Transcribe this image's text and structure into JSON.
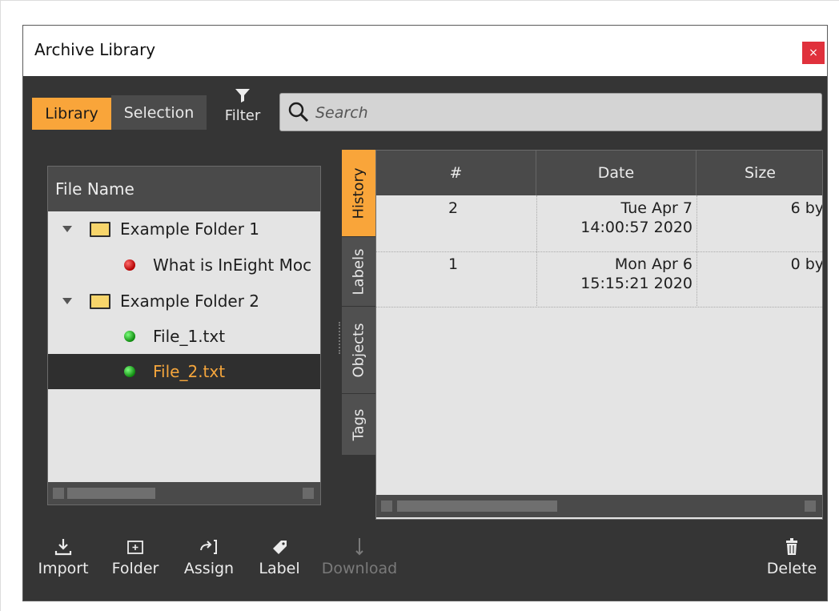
{
  "window": {
    "title": "Archive Library",
    "close_label": "×"
  },
  "tabs": {
    "library": "Library",
    "selection": "Selection"
  },
  "filter": {
    "label": "Filter",
    "icon": "funnel-icon"
  },
  "search": {
    "placeholder": "Search",
    "value": ""
  },
  "tree": {
    "header": "File Name",
    "rows": [
      {
        "label": "Example Folder 1",
        "type": "folder",
        "expanded": true
      },
      {
        "label": "What is InEight Moc",
        "type": "file",
        "status": "red"
      },
      {
        "label": "Example Folder 2",
        "type": "folder",
        "expanded": true
      },
      {
        "label": "File_1.txt",
        "type": "file",
        "status": "green"
      },
      {
        "label": "File_2.txt",
        "type": "file",
        "status": "green",
        "selected": true
      }
    ]
  },
  "side_tabs": [
    "History",
    "Labels",
    "Objects",
    "Tags"
  ],
  "side_tabs_active": "History",
  "history": {
    "columns": [
      "#",
      "Date",
      "Size"
    ],
    "rows": [
      {
        "num": "2",
        "date_line1": "Tue Apr 7",
        "date_line2": "14:00:57 2020",
        "size": "6 by"
      },
      {
        "num": "1",
        "date_line1": "Mon Apr 6",
        "date_line2": "15:15:21 2020",
        "size": "0 by"
      }
    ]
  },
  "toolbar": {
    "import": "Import",
    "folder": "Folder",
    "assign": "Assign",
    "label": "Label",
    "download": "Download",
    "delete": "Delete"
  },
  "colors": {
    "accent": "#f9a53a",
    "panel": "#353535",
    "close": "#e0313c"
  }
}
